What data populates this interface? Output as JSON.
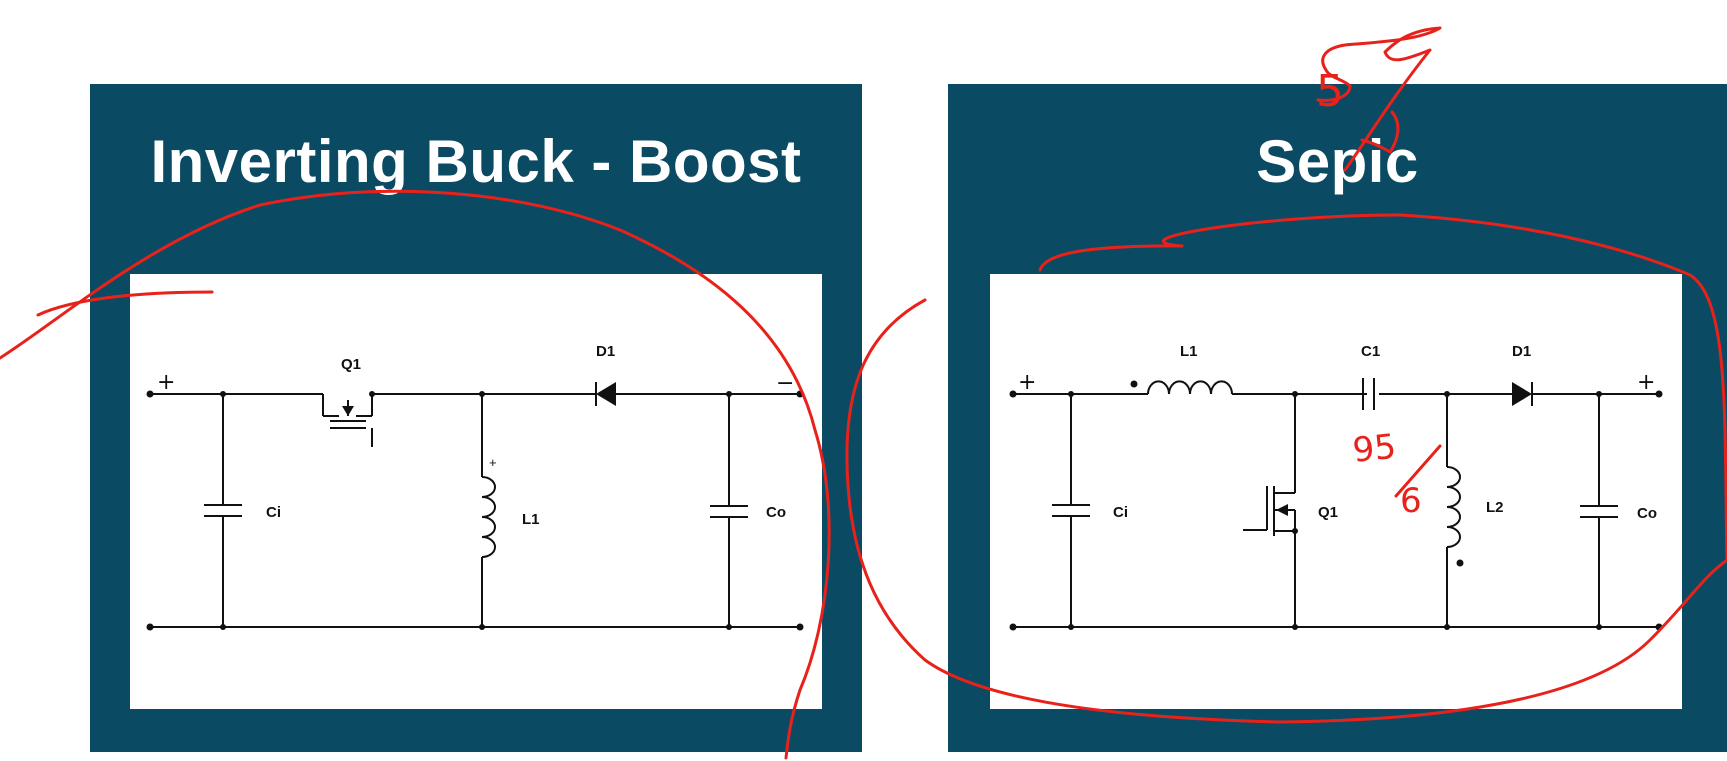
{
  "slide": {
    "left_panel": {
      "title": "Inverting Buck - Boost",
      "labels": {
        "q1": "Q1",
        "d1": "D1",
        "ci": "Ci",
        "co": "Co",
        "l1": "L1",
        "in_plus": "+",
        "out_minus": "−",
        "l1_plus": "+"
      }
    },
    "right_panel": {
      "title": "Sepic",
      "labels": {
        "l1": "L1",
        "c1": "C1",
        "d1": "D1",
        "ci": "Ci",
        "q1": "Q1",
        "l2": "L2",
        "co": "Co",
        "in_plus": "+",
        "out_plus": "+"
      }
    },
    "annotations": {
      "handwritten_top": "5",
      "handwritten_c1_a": "95",
      "handwritten_c1_b": "6"
    },
    "colors": {
      "panel_background": "#0b4a63",
      "title_text": "#ffffff",
      "ink": "#e8221b"
    }
  }
}
